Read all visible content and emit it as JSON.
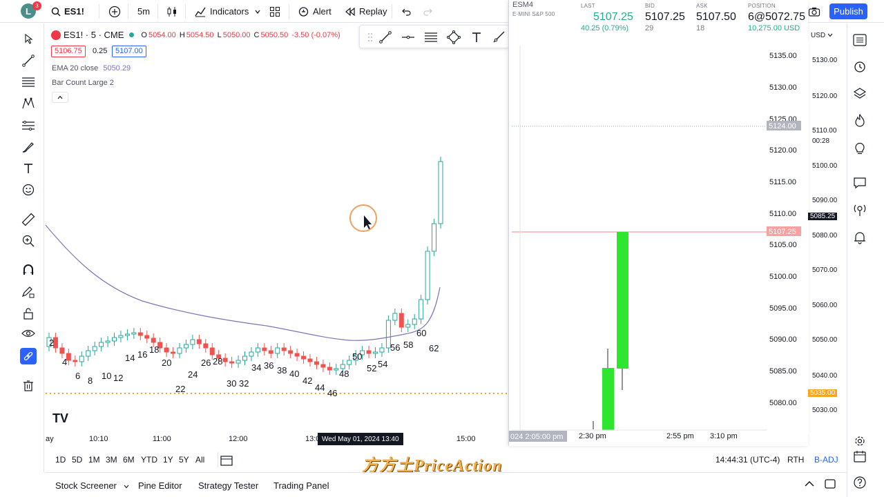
{
  "topbar": {
    "avatar_letter": "L",
    "notification_count": "3",
    "symbol": "ES1!",
    "interval": "5m",
    "indicators_label": "Indicators",
    "alert_label": "Alert",
    "replay_label": "Replay",
    "publish_label": "Publish"
  },
  "legend": {
    "symbol_line": "ES1! · 5 · CME",
    "open_label": "O",
    "open": "5054.00",
    "high_label": "H",
    "high": "5054.50",
    "low_label": "L",
    "low": "5050.00",
    "close_label": "C",
    "close": "5050.50",
    "change": "-3.50 (-0.07%)",
    "bid_box": "5106.75",
    "spread": "0.25",
    "ask_box": "5107.00",
    "ema_label": "EMA 20 close",
    "ema_value": "5050.29",
    "bar_count_label": "Bar Count Large 2"
  },
  "bar_numbers": [
    "2",
    "4",
    "6",
    "8",
    "10",
    "12",
    "14",
    "16",
    "18",
    "20",
    "22",
    "24",
    "26",
    "28",
    "30",
    "32",
    "34",
    "36",
    "38",
    "40",
    "42",
    "44",
    "46",
    "48",
    "50",
    "52",
    "54",
    "56",
    "58",
    "60",
    "62"
  ],
  "time_axis": {
    "ticks": [
      "ay",
      "10:10",
      "11:00",
      "12:00",
      "13:0",
      "15:00"
    ],
    "crosshair_label": "Wed May 01, 2024  13:40"
  },
  "range_buttons": [
    "1D",
    "5D",
    "1M",
    "3M",
    "6M",
    "YTD",
    "1Y",
    "5Y",
    "All"
  ],
  "status": {
    "clock": "14:44:31 (UTC-4)",
    "session": "RTH",
    "adjust": "B-ADJ"
  },
  "bottom_tabs": [
    "Stock Screener",
    "Pine Editor",
    "Strategy Tester",
    "Trading Panel"
  ],
  "watermark": "方方土PriceAction",
  "dom_panel": {
    "symbol": "ESM4",
    "description": "E-MINI S&P 500",
    "last_label": "LAST",
    "last": "5107.25",
    "last_change": "40.25 (0.79%)",
    "bid_label": "BID",
    "bid": "5107.25",
    "bid_size": "29",
    "ask_label": "ASK",
    "ask": "5107.50",
    "ask_size": "18",
    "position_label": "POSITION",
    "position": "6@5072.75",
    "position_value": "10,275.00 USD",
    "price_axis": [
      "5135.00",
      "5130.00",
      "5125.00",
      "5120.00",
      "5115.00",
      "5110.00",
      "5105.00",
      "5100.00",
      "5095.00",
      "5090.00",
      "5085.00",
      "5080.00"
    ],
    "tag_gray": "5124.00",
    "tag_red": "5107.25",
    "time_ticks": [
      "2:30 pm",
      "2:55 pm",
      "3:10 pm"
    ],
    "time_crosshair": "024 2:05:00 pm"
  },
  "main_price_axis": {
    "currency": "USD",
    "labels": [
      "5130.00",
      "5120.00",
      "5110.00",
      "5100.00",
      "5090.00",
      "5080.00",
      "5070.00",
      "5060.00",
      "5050.00",
      "5040.00",
      "5030.00"
    ],
    "countdown": "00:28",
    "tag_dark": "5085.25",
    "tag_orange": "5035.00"
  },
  "colors": {
    "accent": "#2962ff",
    "up": "#26a69a",
    "down": "#ef5350",
    "ema": "#7b74b8",
    "dom_bar": "#2ee62e",
    "level_line": "#f5a623"
  }
}
